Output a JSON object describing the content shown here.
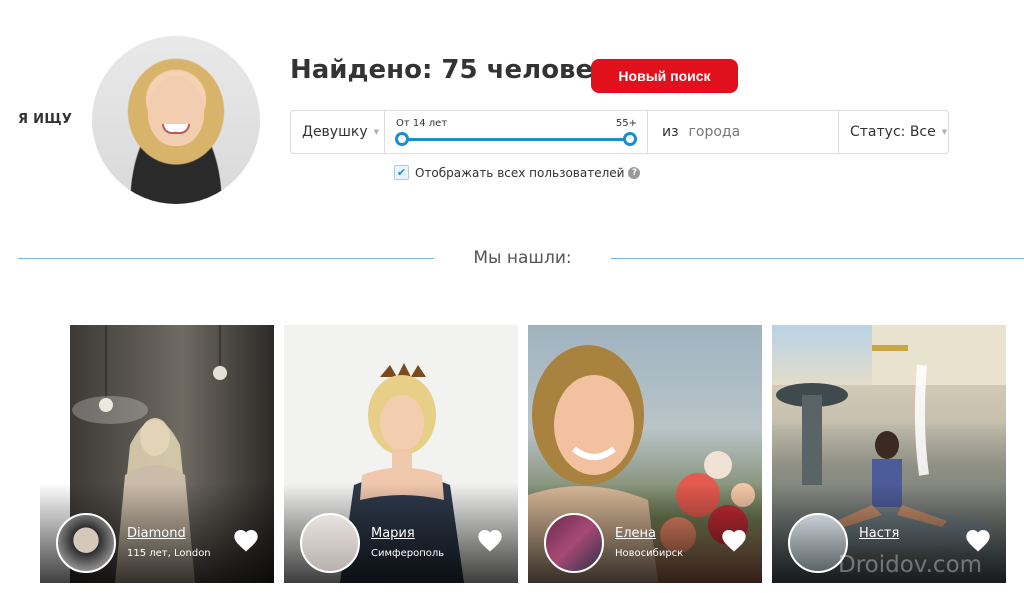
{
  "seek_label": "Я ИЩУ",
  "header": {
    "found_title": "Найдено: 75 человек",
    "new_search_label": "Новый поиск"
  },
  "filters": {
    "gender_value": "Девушку",
    "age_from_label": "От 14 лет",
    "age_to_label": "55+",
    "age_range": [
      14,
      55
    ],
    "city_prefix": "из",
    "city_placeholder": "города",
    "status_value": "Статус: Все"
  },
  "show_all": {
    "label": "Отображать всех пользователей",
    "checked": true,
    "help_glyph": "?"
  },
  "results_heading": "Мы нашли:",
  "cards": [
    {
      "name": "Diamond",
      "subtitle": "115 лет, London"
    },
    {
      "name": "Мария",
      "subtitle": "Симферополь"
    },
    {
      "name": "Елена",
      "subtitle": "Новосибирск"
    },
    {
      "name": "Настя",
      "subtitle": ""
    }
  ],
  "watermark": "Droidov.com",
  "colors": {
    "accent_blue": "#1a8ed1",
    "button_red": "#e0101c",
    "divider": "#6fb8e3"
  },
  "icons": {
    "like": "heart-icon",
    "select_caret": "chevron-down-icon",
    "help": "question-icon",
    "check": "checkmark-icon"
  }
}
